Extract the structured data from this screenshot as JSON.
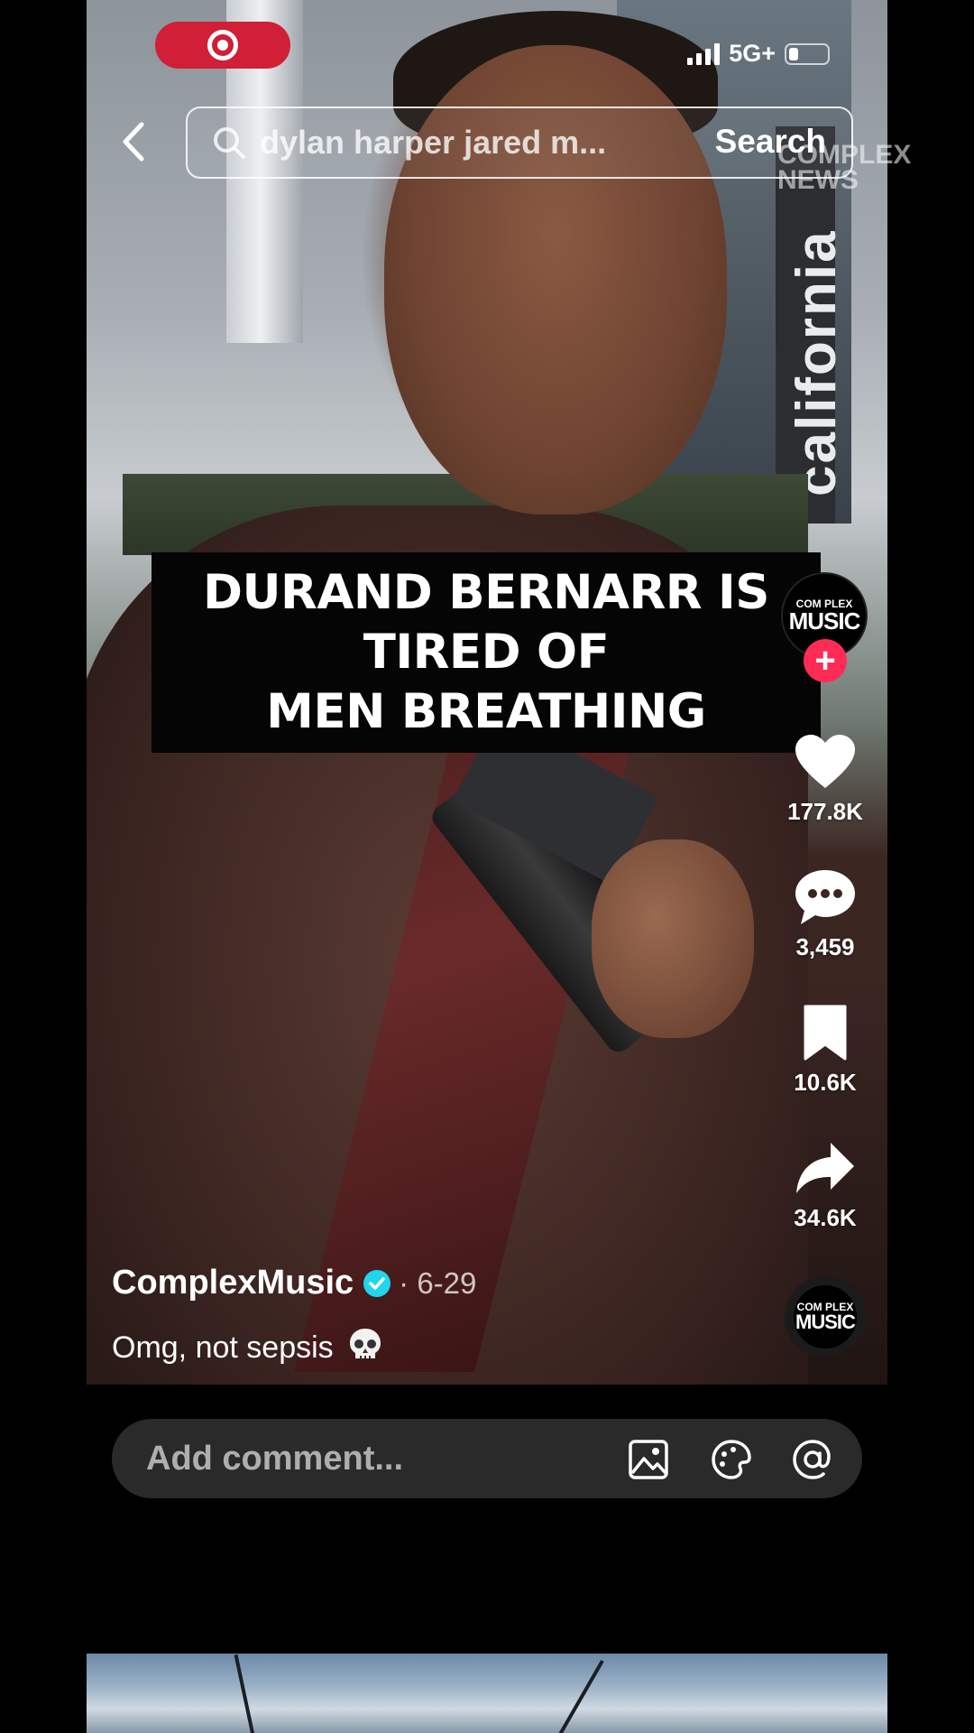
{
  "status_bar": {
    "network": "5G+"
  },
  "search": {
    "query": "dylan harper jared m...",
    "button_label": "Search"
  },
  "video": {
    "caption_lines": [
      "DURAND BERNARR IS",
      "TIRED OF",
      "MEN BREATHING"
    ],
    "background_text": "california",
    "watermark": "COMPLEX NEWS"
  },
  "creator_avatar": {
    "small": "COM PLEX",
    "big": "MUSIC"
  },
  "actions": {
    "likes": "177.8K",
    "comments": "3,459",
    "saves": "10.6K",
    "shares": "34.6K"
  },
  "post": {
    "author": "ComplexMusic",
    "date": "· 6-29",
    "caption": "Omg, not sepsis"
  },
  "comment_bar": {
    "placeholder": "Add comment..."
  },
  "icons": {
    "back": "chevron-left-icon",
    "search": "search-icon",
    "like": "heart-icon",
    "comment": "comment-bubble-icon",
    "save": "bookmark-icon",
    "share": "share-arrow-icon",
    "image": "image-icon",
    "emoji": "emoji-icon",
    "mention": "at-icon"
  },
  "colors": {
    "brand_red": "#d01f37",
    "follow_pink": "#fe2c55",
    "verified_teal": "#20d5ec"
  }
}
